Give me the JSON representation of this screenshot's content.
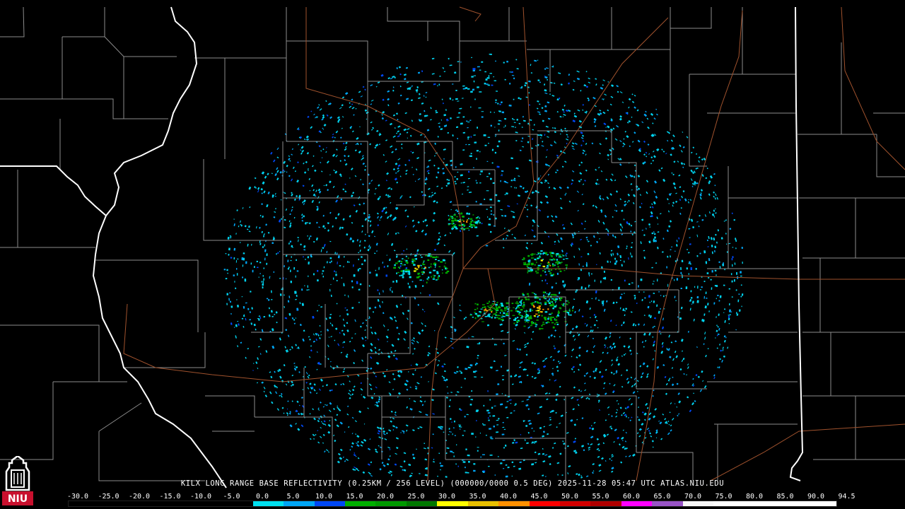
{
  "header": {
    "caption": "KILX LONG RANGE BASE REFLECTIVITY (0.25KM / 256 LEVEL) (000000/0000 0.5 DEG) 2025-11-28 05:47 UTC  ATLAS.NIU.EDU"
  },
  "logo": {
    "text": "NIU",
    "icon": "niu-tower-logo-icon",
    "color": "#c8102e"
  },
  "legend": {
    "ticks": [
      "-30.0",
      "-25.0",
      "-20.0",
      "-15.0",
      "-10.0",
      "-5.0",
      "0.0",
      "5.0",
      "10.0",
      "15.0",
      "20.0",
      "25.0",
      "30.0",
      "35.0",
      "40.0",
      "45.0",
      "50.0",
      "55.0",
      "60.0",
      "65.0",
      "70.0",
      "75.0",
      "80.0",
      "85.0",
      "90.0",
      "94.5"
    ],
    "colors": [
      "#000000",
      "#000000",
      "#000000",
      "#000000",
      "#000000",
      "#000000",
      "#00e0f0",
      "#00a6f6",
      "#0048f6",
      "#00b000",
      "#009a00",
      "#007800",
      "#ffff00",
      "#e8c000",
      "#ff9000",
      "#ff0000",
      "#d40000",
      "#b00000",
      "#ff00ff",
      "#9854c6",
      "#f8f8f8",
      "#ffffff",
      "#ffffff",
      "#ffffff",
      "#ffffff"
    ]
  },
  "map": {
    "radar_site": "KILX",
    "boundary_colors": {
      "state": "#ffffff",
      "county": "#9a9a9a",
      "road": "#a0522d"
    }
  }
}
